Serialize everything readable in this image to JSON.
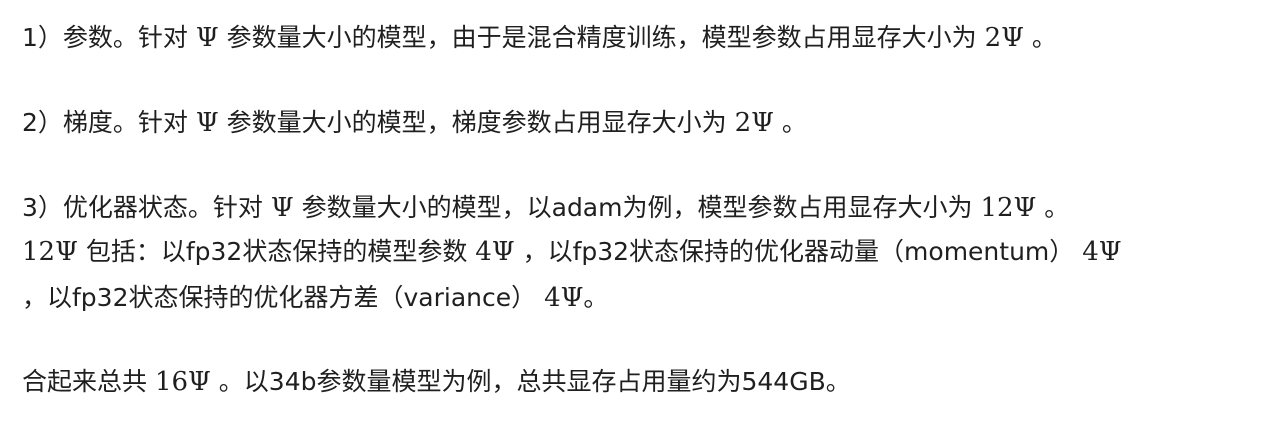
{
  "doc": {
    "p1": {
      "a": "1）参数。针对 ",
      "m1": "Ψ",
      "b": " 参数量大小的模型，由于是混合精度训练，模型参数占用显存大小为 ",
      "m2": "2Ψ",
      "c": " 。"
    },
    "p2": {
      "a": "2）梯度。针对 ",
      "m1": "Ψ",
      "b": " 参数量大小的模型，梯度参数占用显存大小为 ",
      "m2": "2Ψ",
      "c": " 。"
    },
    "p3": {
      "line1": {
        "a": "3）优化器状态。针对 ",
        "m1": "Ψ",
        "b": " 参数量大小的模型，以adam为例，模型参数占用显存大小为 ",
        "m2": "12Ψ",
        "c": " 。"
      },
      "line2": {
        "m1": "12Ψ",
        "a": " 包括：以fp32状态保持的模型参数 ",
        "m2": "4Ψ",
        "b": " ，以fp32状态保持的优化器动量（momentum） ",
        "m3": "4Ψ"
      },
      "line3": {
        "a": "，以fp32状态保持的优化器方差（variance） ",
        "m1": "4Ψ",
        "b": "。"
      }
    },
    "p4": {
      "a": "合起来总共 ",
      "m1": "16Ψ",
      "b": " 。以34b参数量模型为例，总共显存占用量约为544GB。"
    }
  }
}
